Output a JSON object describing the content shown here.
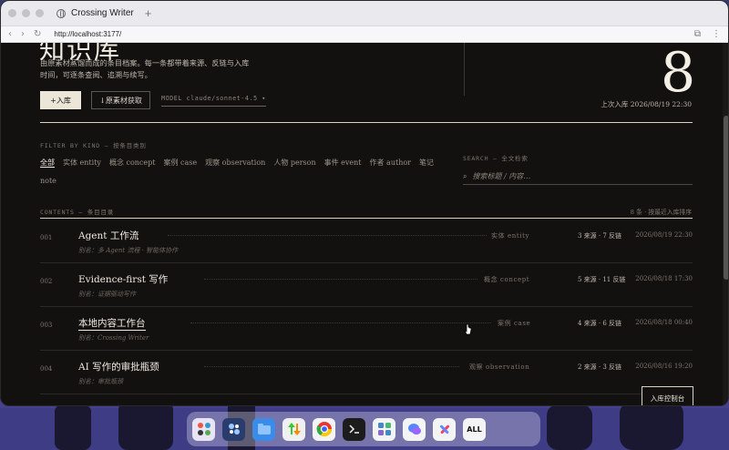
{
  "browser": {
    "tab_title": "Crossing Writer",
    "new_tab_symbol": "+",
    "url": "http://localhost:3177/",
    "back_symbol": "‹",
    "forward_symbol": "›",
    "reload_symbol": "↻",
    "extension_symbol": "⧉",
    "menu_symbol": "⋮"
  },
  "header": {
    "big_title": "知识库",
    "intro": "由原素材蒸馏而成的条目档案。每一条都带着来源、反链与入库时间，可逐条查阅、追溯与续写。",
    "entry_count": "8",
    "last_ingest": "上次入库 2026/08/19 22:30"
  },
  "toolbar": {
    "add_label": "+入库",
    "source_label": "↓原素材获取",
    "model_label": "MODEL claude/sonnet-4.5 ▾"
  },
  "filter": {
    "label": "FILTER BY KIND — 按条目类别",
    "options": [
      "全部",
      "实体 entity",
      "概念 concept",
      "案例 case",
      "观察 observation",
      "人物 person",
      "事件 event",
      "作者 author",
      "笔记 note"
    ],
    "active": "全部"
  },
  "search": {
    "label": "SEARCH — 全文检索",
    "placeholder": "搜索标题 / 内容…",
    "icon": "magnifier-icon"
  },
  "contents": {
    "label": "CONTENTS — 条目目录",
    "summary": "8 条 · 按最近入库排序",
    "rows": [
      {
        "num": "001",
        "title": "Agent 工作流",
        "alias": "别名：多 Agent 流程 · 智能体协作",
        "kind": "实体 entity",
        "counts": "3 来源 · 7 反链",
        "date": "2026/08/19 22:30"
      },
      {
        "num": "002",
        "title": "Evidence-first 写作",
        "alias": "别名：证据驱动写作",
        "kind": "概念 concept",
        "counts": "5 来源 · 11 反链",
        "date": "2026/08/18 17:30"
      },
      {
        "num": "003",
        "title": "本地内容工作台",
        "alias": "别名：Crossing Writer",
        "kind": "案例 case",
        "counts": "4 来源 · 6 反链",
        "date": "2026/08/18 00:40"
      },
      {
        "num": "004",
        "title": "AI 写作的审批瓶颈",
        "alias": "别名：审批瓶颈",
        "kind": "观察 observation",
        "counts": "2 来源 · 3 反链",
        "date": "2026/08/16 19:20"
      }
    ]
  },
  "console_button": "入库控制台",
  "dock": {
    "all_label": "ALL",
    "icons": [
      "app-grid-icon",
      "settings-icon",
      "finder-folder-icon",
      "transfer-icon",
      "chrome-icon",
      "terminal-icon",
      "launchpad-icon",
      "chat-icon",
      "tools-icon",
      "all-apps-icon"
    ]
  },
  "colors": {
    "page_bg": "#121110",
    "text_primary": "#f1ece1",
    "accent_button": "#ece6d8",
    "desktop_bg": "#5650b8"
  }
}
